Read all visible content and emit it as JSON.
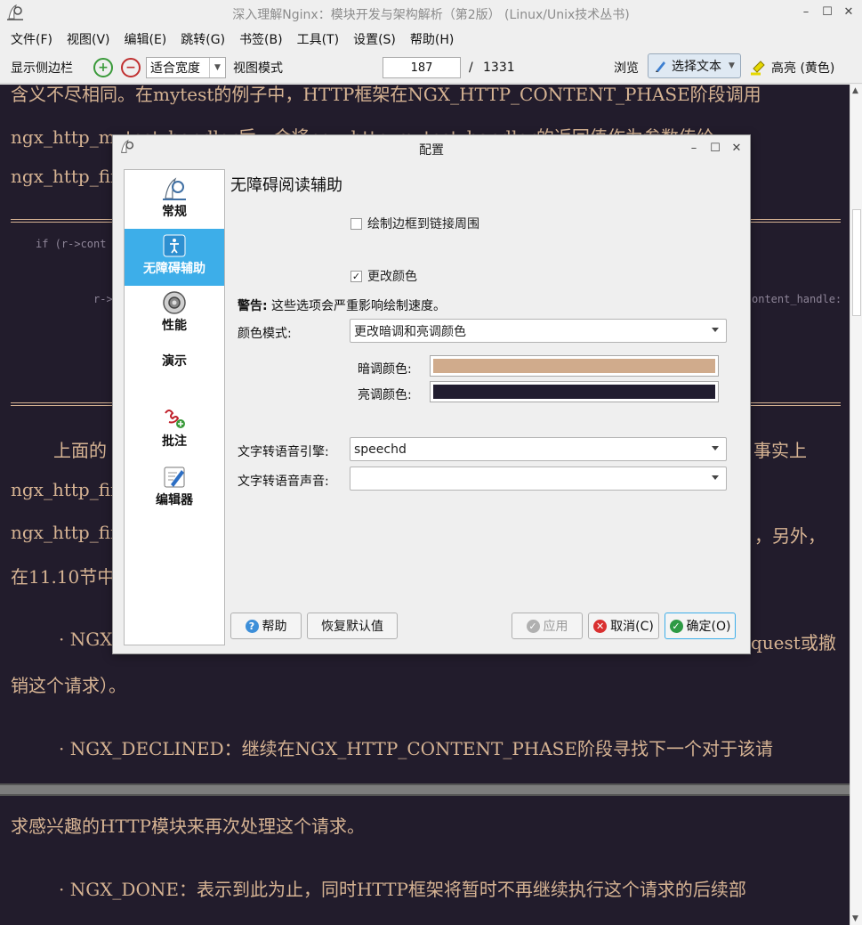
{
  "window": {
    "title": "深入理解Nginx：模块开发与架构解析（第2版） (Linux/Unix技术丛书)",
    "min_glyph": "–",
    "max_glyph": "☐",
    "close_glyph": "✕"
  },
  "menu": [
    "文件(F)",
    "视图(V)",
    "编辑(E)",
    "跳转(G)",
    "书签(B)",
    "工具(T)",
    "设置(S)",
    "帮助(H)"
  ],
  "toolbar": {
    "sidebar_toggle": "显示侧边栏",
    "zoom_mode": "适合宽度",
    "view_mode": "视图模式",
    "page_current": "187",
    "page_sep": "/",
    "page_total": "1331",
    "browse": "浏览",
    "select_text": "选择文本",
    "highlight": "高亮 (黄色)"
  },
  "document": {
    "lines": [
      "含义不尽相同。在mytest的例子中，HTTP框架在NGX_HTTP_CONTENT_PHASE阶段调用",
      "ngx_http_mytest_handler后，会将ngx_http_mytest_handler的返回值作为参数传给",
      "ngx_http_fin",
      "上面的",
      "事实上",
      "ngx_http_fin",
      "ngx_http_fin",
      "，另外，",
      "在11.10节中",
      "· NGX",
      "quest或撤",
      "销这个请求）。",
      "· NGX_DECLINED：继续在NGX_HTTP_CONTENT_PHASE阶段寻找下一个对于该请",
      "求感兴趣的HTTP模块来再次处理这个请求。",
      "· NGX_DONE：表示到此为止，同时HTTP框架将暂时不再继续执行这个请求的后续部"
    ],
    "code": [
      "if (r->cont",
      "r->",
      "ontent_handle:"
    ]
  },
  "dialog": {
    "title": "配置",
    "sidebar": [
      {
        "label": "常规",
        "icon": "general-icon"
      },
      {
        "label": "无障碍辅助",
        "icon": "accessibility-icon"
      },
      {
        "label": "性能",
        "icon": "performance-icon"
      },
      {
        "label": "演示",
        "icon": "presentation-icon"
      },
      {
        "label": "批注",
        "icon": "annotation-icon"
      },
      {
        "label": "编辑器",
        "icon": "editor-icon"
      }
    ],
    "heading": "无障碍阅读辅助",
    "draw_border_label": "绘制边框到链接周围",
    "draw_border_checked": false,
    "change_colors_label": "更改颜色",
    "change_colors_checked": true,
    "warning_bold": "警告:",
    "warning_text": " 这些选项会严重影响绘制速度。",
    "color_mode_label": "颜色模式:",
    "color_mode_value": "更改暗调和亮调颜色",
    "dark_color_label": "暗调颜色:",
    "dark_color": "#d0ab8c",
    "light_color_label": "亮调颜色:",
    "light_color": "#211d30",
    "tts_engine_label": "文字转语音引擎:",
    "tts_engine_value": "speechd",
    "tts_voice_label": "文字转语音声音:",
    "tts_voice_value": "",
    "buttons": {
      "help": "帮助",
      "defaults": "恢复默认值",
      "apply": "应用",
      "cancel": "取消(C)",
      "ok": "确定(O)"
    }
  }
}
